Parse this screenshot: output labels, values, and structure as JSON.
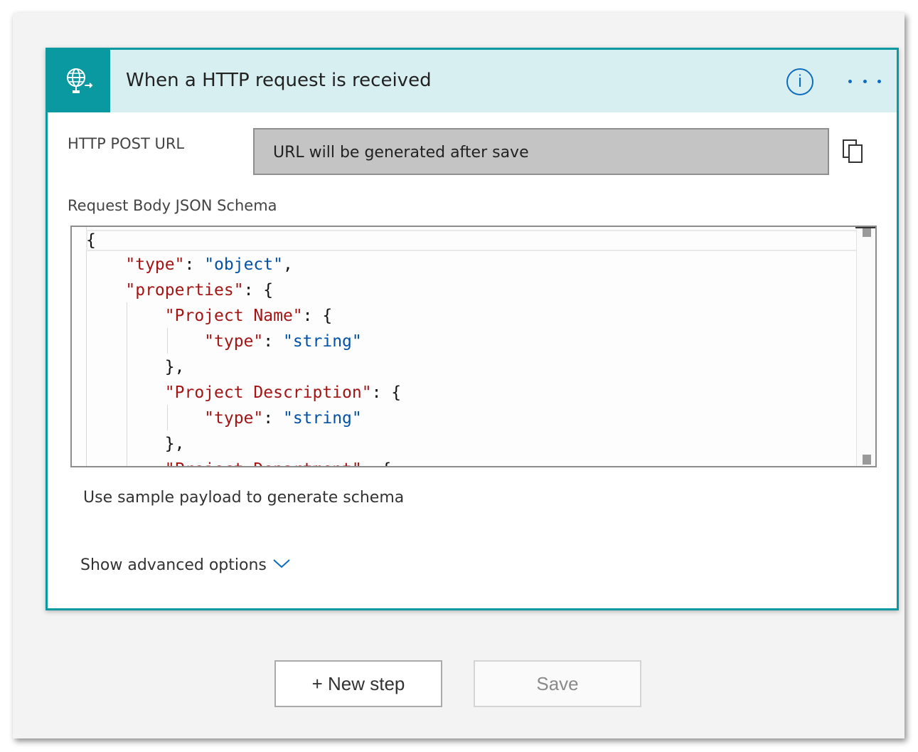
{
  "trigger": {
    "title": "When a HTTP request is received",
    "icon": "http-globe-icon",
    "accent_color": "#0a99a1",
    "header_bg": "#d8eff2"
  },
  "fields": {
    "post_url_label": "HTTP POST URL",
    "post_url_value": "URL will be generated after save",
    "schema_label": "Request Body JSON Schema"
  },
  "editor": {
    "lines": [
      "{",
      "    \"type\": \"object\",",
      "    \"properties\": {",
      "        \"Project Name\": {",
      "            \"type\": \"string\"",
      "        },",
      "        \"Project Description\": {",
      "            \"type\": \"string\"",
      "        },",
      "        \"Project Department\": {"
    ]
  },
  "links": {
    "sample_payload": "Use sample payload to generate schema",
    "advanced_options": "Show advanced options"
  },
  "actions": {
    "new_step": "+ New step",
    "save": "Save"
  }
}
